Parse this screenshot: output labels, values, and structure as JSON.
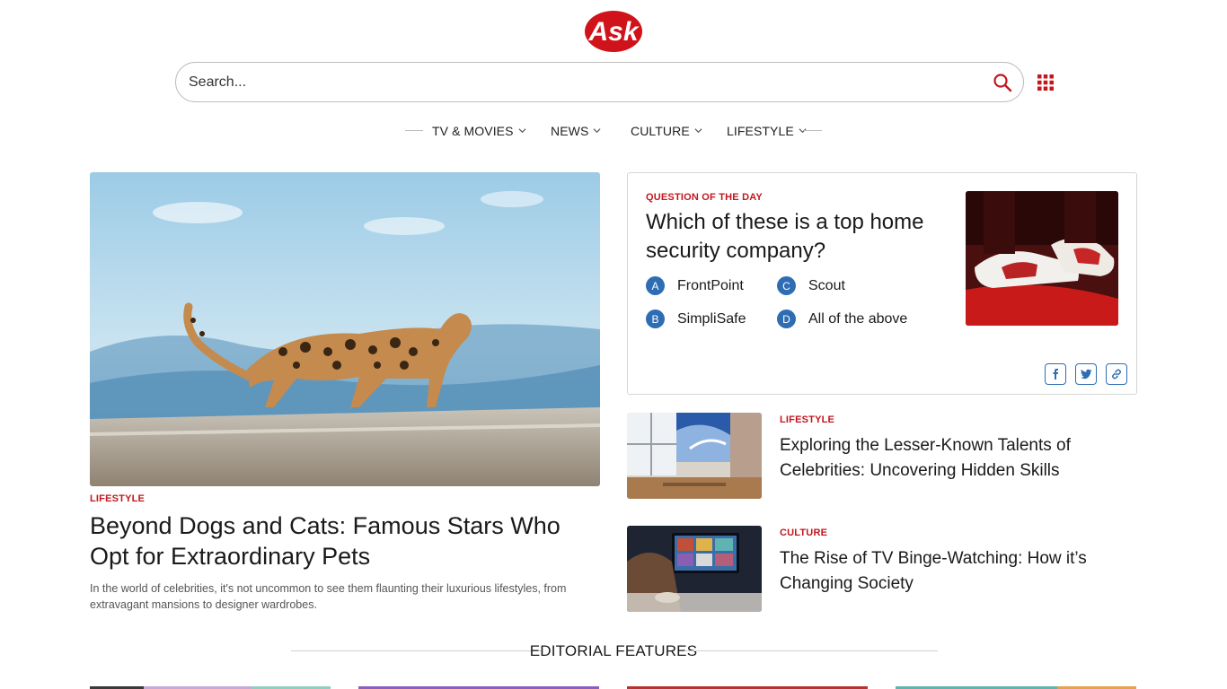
{
  "header": {
    "logo_text": "Ask",
    "search_placeholder": "Search...",
    "nav": [
      "TV & MOVIES",
      "NEWS",
      "CULTURE",
      "LIFESTYLE"
    ]
  },
  "hero": {
    "category": "LIFESTYLE",
    "title": "Beyond Dogs and Cats: Famous Stars Who Opt for Extraordinary Pets",
    "description": "In the world of celebrities, it's not uncommon to see them flaunting their luxurious lifestyles, from extravagant mansions to designer wardrobes."
  },
  "qotd": {
    "label": "QUESTION OF THE DAY",
    "question": "Which of these is a top home security company?",
    "options": [
      {
        "letter": "A",
        "text": "FrontPoint"
      },
      {
        "letter": "B",
        "text": "SimpliSafe"
      },
      {
        "letter": "C",
        "text": "Scout"
      },
      {
        "letter": "D",
        "text": "All of the above"
      }
    ]
  },
  "side_articles": [
    {
      "category": "LIFESTYLE",
      "title": "Exploring the Lesser-Known Talents of Celebrities: Uncovering Hidden Skills"
    },
    {
      "category": "CULTURE",
      "title": "The Rise of TV Binge-Watching: How it’s Changing Society"
    }
  ],
  "editorial": {
    "title": "EDITORIAL FEATURES"
  },
  "colors": {
    "accent_red": "#c4161c",
    "accent_blue": "#2e6db4"
  },
  "icons": [
    "search-icon",
    "apps-grid-icon",
    "chevron-down-icon",
    "facebook-icon",
    "twitter-icon",
    "link-icon"
  ]
}
